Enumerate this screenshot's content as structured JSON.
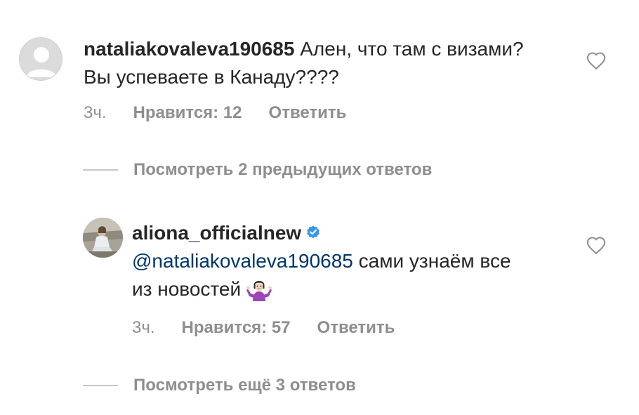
{
  "comments": [
    {
      "username": "nataliakovaleva190685",
      "text": " Ален, что там с визами? Вы успеваете в Канаду????",
      "time": "3ч.",
      "likes": "Нравится: 12",
      "reply_label": "Ответить",
      "view_replies": "Посмотреть 2 предыдущих ответов"
    },
    {
      "username": "aliona_officialnew",
      "verified": true,
      "mention": "@nataliakovaleva190685",
      "text": "  сами узнаём все из новостей",
      "emoji": "person-shrugging-emoji",
      "time": "3ч.",
      "likes": "Нравится: 57",
      "reply_label": "Ответить",
      "view_replies": "Посмотреть ещё 3 ответов"
    }
  ],
  "icons": {
    "like": "heart-icon",
    "verified": "verified-badge-icon"
  },
  "colors": {
    "text": "#262626",
    "secondary": "#8e8e8e",
    "mention": "#00376b",
    "verified": "#3897f0"
  }
}
